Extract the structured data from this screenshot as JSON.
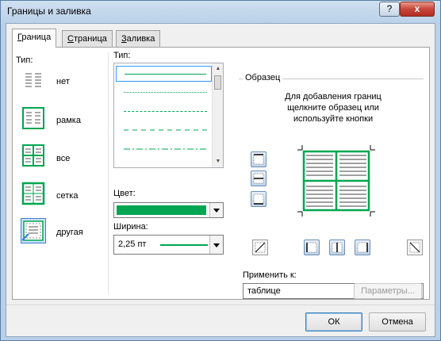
{
  "window": {
    "title": "Границы и заливка"
  },
  "titlebar": {
    "help": "?",
    "close": "x"
  },
  "tabs": [
    {
      "label": "Граница",
      "u": "Г",
      "rest": "раница"
    },
    {
      "label": "Страница",
      "u": "С",
      "rest": "траница"
    },
    {
      "label": "Заливка",
      "u": "З",
      "rest": "аливка"
    }
  ],
  "settings": {
    "label": "Тип:",
    "items": [
      {
        "label": "нет",
        "icon": "border-none-icon"
      },
      {
        "label": "рамка",
        "icon": "border-box-icon"
      },
      {
        "label": "все",
        "icon": "border-all-icon"
      },
      {
        "label": "сетка",
        "icon": "border-grid-icon"
      },
      {
        "label": "другая",
        "icon": "border-custom-icon",
        "selected": true
      }
    ]
  },
  "style": {
    "label": "Тип:"
  },
  "color": {
    "label": "Цвет:",
    "value": "#00a651"
  },
  "width": {
    "label": "Ширина:",
    "value": "2,25 пт"
  },
  "preview": {
    "label": "Образец",
    "hint": [
      "Для добавления границ",
      "щелкните образец или",
      "используйте кнопки"
    ]
  },
  "apply": {
    "label": "Применить к:",
    "value": "таблице"
  },
  "buttons": {
    "options": "Параметры...",
    "ok": "ОК",
    "cancel": "Отмена"
  },
  "colors": {
    "accent": "#00a651"
  }
}
